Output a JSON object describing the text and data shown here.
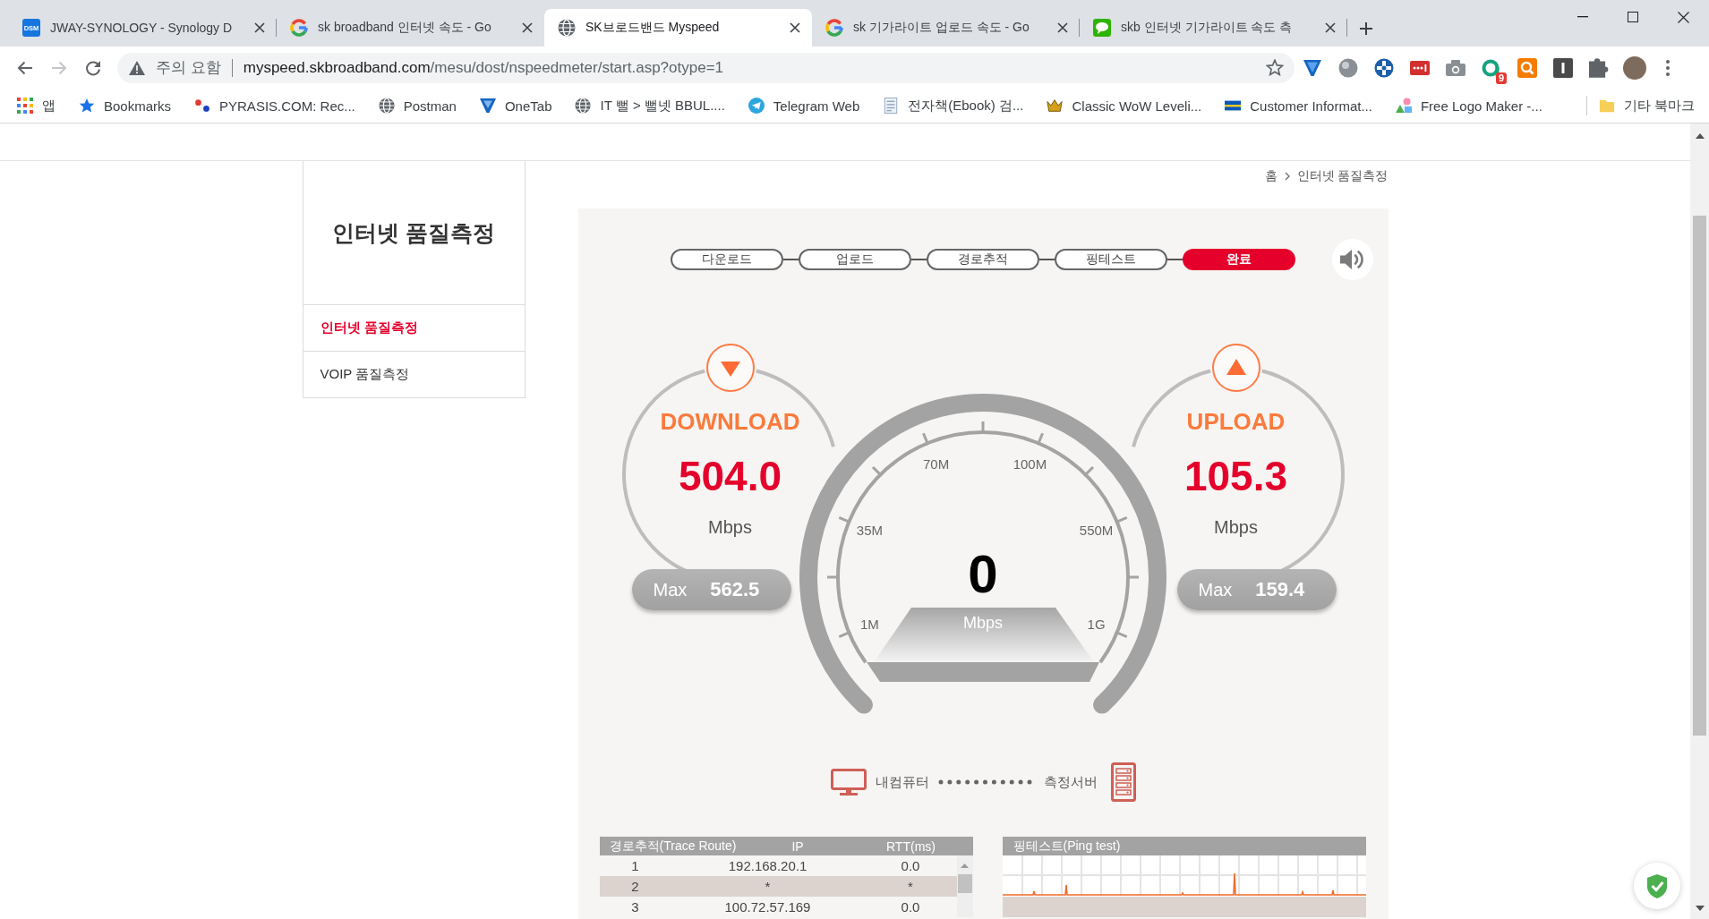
{
  "tabs": [
    {
      "title": "JWAY-SYNOLOGY - Synology D",
      "kind": "dsm",
      "favicon_text": "DSM",
      "selected": false
    },
    {
      "title": "sk broadband 인터넷 속도 - Go",
      "kind": "google",
      "selected": false
    },
    {
      "title": "SK브로드밴드 Myspeed",
      "kind": "globe",
      "selected": true
    },
    {
      "title": "sk 기가라이트 업로드 속도 - Go",
      "kind": "google",
      "selected": false
    },
    {
      "title": "skb 인터넷 기가라이트 속도 측",
      "kind": "blog",
      "selected": false
    }
  ],
  "navigation": [
    {
      "kind": "back",
      "disabled": false
    },
    {
      "kind": "forward",
      "disabled": true
    },
    {
      "kind": "reload",
      "disabled": false
    }
  ],
  "address_bar": {
    "security_label": "주의 요함",
    "url_host": "myspeed.skbroadband.com",
    "url_path": "/mesu/dost/nspeedmeter/start.asp?otype=1"
  },
  "extension_badge": "9",
  "bookmarks": [
    {
      "label": "앱",
      "kind": "apps"
    },
    {
      "label": "Bookmarks",
      "kind": "star"
    },
    {
      "label": "PYRASIS.COM: Rec...",
      "kind": "dots"
    },
    {
      "label": "Postman",
      "kind": "globe"
    },
    {
      "label": "OneTab",
      "kind": "funnel"
    },
    {
      "label": "IT 뻘 > 뻘넷 BBUL....",
      "kind": "globe"
    },
    {
      "label": "Telegram Web",
      "kind": "plane"
    },
    {
      "label": "전자책(Ebook) 검...",
      "kind": "document"
    },
    {
      "label": "Classic WoW Leveli...",
      "kind": "crown"
    },
    {
      "label": "Customer Informat...",
      "kind": "stripes"
    },
    {
      "label": "Free Logo Maker -...",
      "kind": "shapes"
    }
  ],
  "other_bookmarks": {
    "label": "기타 북마크"
  },
  "sidebar": {
    "title": "인터넷 품질측정",
    "items": [
      {
        "label": "인터넷 품질측정",
        "selected": true
      },
      {
        "label": "VOIP 품질측정",
        "selected": false
      }
    ]
  },
  "breadcrumb": [
    "홈",
    "인터넷 품질측정"
  ],
  "steps": [
    {
      "label": "다운로드",
      "selected": false
    },
    {
      "label": "업로드",
      "selected": false
    },
    {
      "label": "경로추적",
      "selected": false
    },
    {
      "label": "핑테스트",
      "selected": false
    },
    {
      "label": "완료",
      "selected": true
    }
  ],
  "download": {
    "title": "DOWNLOAD",
    "value": "504.0",
    "unit": "Mbps",
    "max_label": "Max",
    "max_value": "562.5"
  },
  "dial": {
    "value": "0",
    "unit": "Mbps",
    "scale_labels": [
      "1M",
      "35M",
      "70M",
      "100M",
      "550M",
      "1G"
    ]
  },
  "upload": {
    "title": "UPLOAD",
    "value": "105.3",
    "unit": "Mbps",
    "max_label": "Max",
    "max_value": "159.4"
  },
  "connection": {
    "from": "내컴퓨터",
    "to": "측정서버"
  },
  "trace_route": {
    "columns": [
      "경로추적(Trace Route)",
      "IP",
      "RTT(ms)"
    ],
    "rows": [
      [
        "1",
        "192.168.20.1",
        "0.0"
      ],
      [
        "2",
        "*",
        "*"
      ],
      [
        "3",
        "100.72.57.169",
        "0.0"
      ]
    ]
  },
  "ping_test": {
    "title": "핑테스트(Ping test)"
  }
}
